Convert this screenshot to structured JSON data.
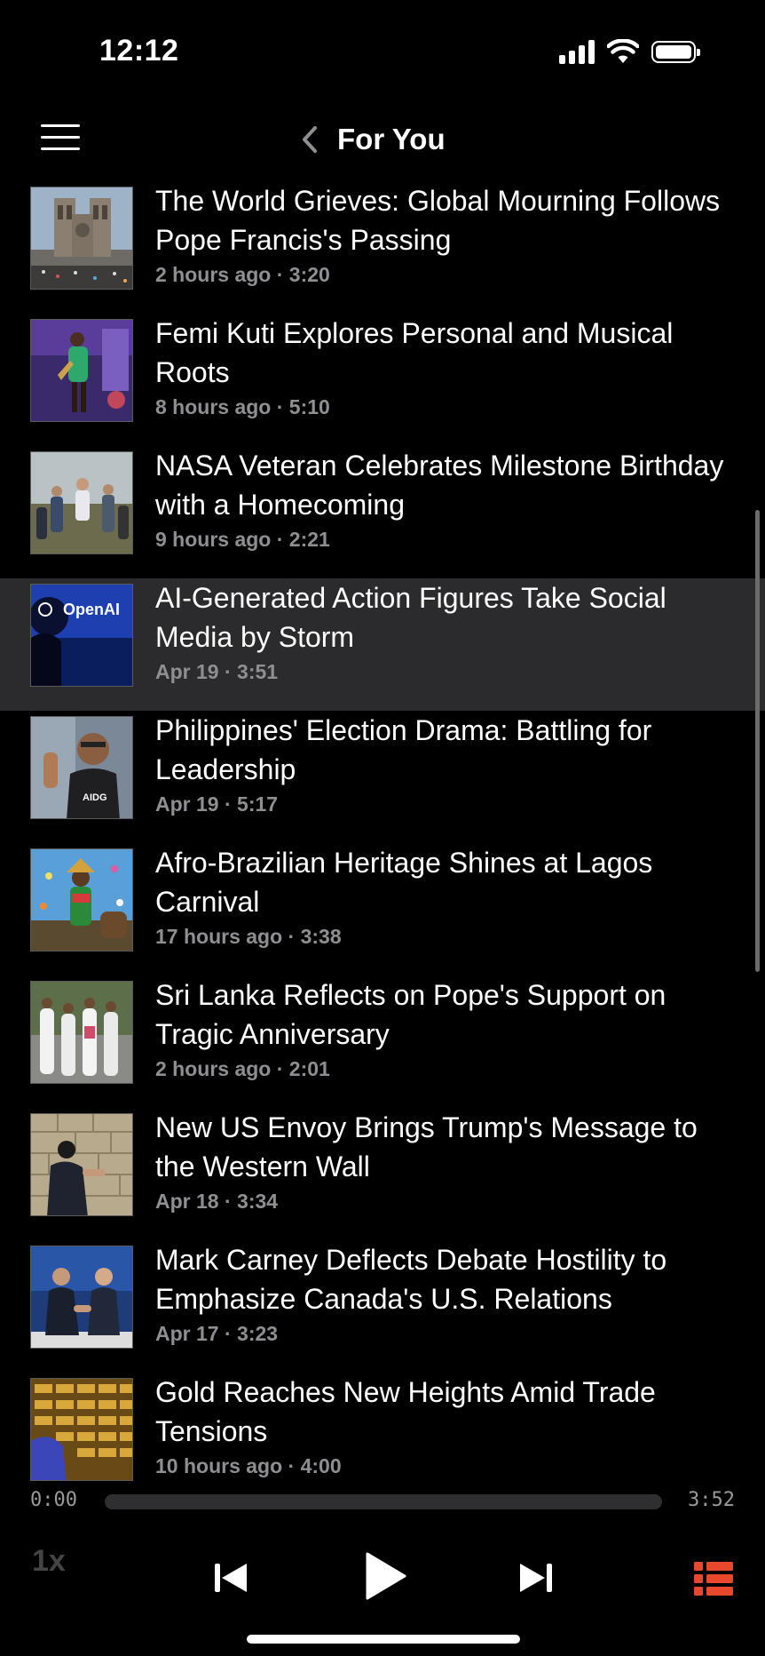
{
  "status_bar": {
    "time": "12:12"
  },
  "nav": {
    "title": "For You"
  },
  "stories": [
    {
      "title": "The World Grieves: Global Mourning Follows Pope Francis's Passing",
      "meta": "2 hours ago · 3:20",
      "thumb": "cathedral-image",
      "selected": false
    },
    {
      "title": "Femi Kuti Explores Personal and Musical Roots",
      "meta": "8 hours ago · 5:10",
      "thumb": "concert-image",
      "selected": false
    },
    {
      "title": "NASA Veteran Celebrates Milestone Birthday with a Homecoming",
      "meta": "9 hours ago · 2:21",
      "thumb": "homecoming-image",
      "selected": false
    },
    {
      "title": "AI-Generated Action Figures Take Social Media by Storm",
      "meta": "Apr 19 · 3:51",
      "thumb": "openai-image",
      "thumb_text": "OpenAI",
      "selected": true
    },
    {
      "title": "Philippines' Election Drama: Battling for Leadership",
      "meta": "Apr 19 · 5:17",
      "thumb": "candidate-image",
      "thumb_text": "AIDG",
      "selected": false
    },
    {
      "title": "Afro-Brazilian Heritage Shines at Lagos Carnival",
      "meta": "17 hours ago · 3:38",
      "thumb": "carnival-image",
      "selected": false
    },
    {
      "title": "Sri Lanka Reflects on Pope's Support on Tragic Anniversary",
      "meta": "2 hours ago · 2:01",
      "thumb": "procession-image",
      "selected": false
    },
    {
      "title": "New US Envoy Brings Trump's Message to the Western Wall",
      "meta": "Apr 18 · 3:34",
      "thumb": "western-wall-image",
      "selected": false
    },
    {
      "title": "Mark Carney Deflects Debate Hostility to Emphasize Canada's U.S. Relations",
      "meta": "Apr 17 · 3:23",
      "thumb": "debate-image",
      "selected": false
    },
    {
      "title": "Gold Reaches New Heights Amid Trade Tensions",
      "meta": "10 hours ago · 4:00",
      "thumb": "gold-image",
      "selected": false
    }
  ],
  "player": {
    "elapsed": "0:00",
    "total": "3:52",
    "progress": 0,
    "speed": "1x",
    "accent_color": "#e8482b"
  },
  "icons": {
    "menu": "hamburger-menu-icon",
    "back": "chevron-left-icon",
    "previous": "skip-back-icon",
    "play": "play-icon",
    "next": "skip-forward-icon",
    "queue": "queue-list-icon"
  }
}
